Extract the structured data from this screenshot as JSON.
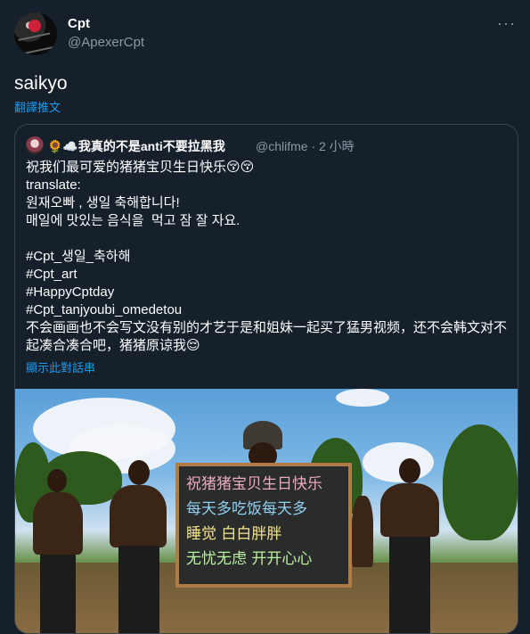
{
  "tweet": {
    "display_name": "Cpt",
    "handle": "@ApexerCpt",
    "more_label": "···",
    "text": "saikyo",
    "translate_label": "翻譯推文"
  },
  "quote": {
    "display_name": "🌻☁️我真的不是anti不要拉黑我",
    "handle_time": "@chlifme · 2 小時",
    "body": "祝我们最可爱的猪猪宝贝生日快乐😚😚\ntranslate:\n원재오빠 , 생일 축해합니다!\n매일에 맛있는 음식을  먹고 잠 잘 자요.\n\n#Cpt_생일_축하해\n#Cpt_art\n#HappyCptday\n#Cpt_tanjyoubi_omedetou\n不会画画也不会写文没有别的才艺于是和姐妹一起买了猛男视频，还不会韩文对不起凑合凑合吧，猪猪原谅我😌",
    "thread_label": "顯示此對話串"
  },
  "media": {
    "board_lines": [
      "祝猪猪宝贝生日快乐",
      "每天多吃饭每天多",
      "睡觉 白白胖胖",
      "无忧无虑 开开心心"
    ]
  },
  "colors": {
    "background": "#15202b",
    "secondary_text": "#8b98a5",
    "link": "#1d9bf0",
    "border": "#38444d"
  }
}
